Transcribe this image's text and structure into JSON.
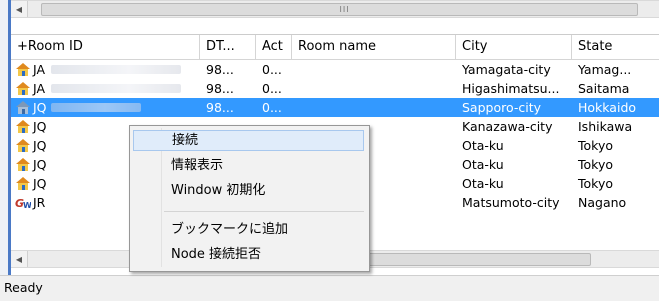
{
  "table": {
    "columns": [
      "+Room ID",
      "DT...",
      "Act",
      "Room name",
      "City",
      "State"
    ],
    "rows": [
      {
        "id_prefix": "JA",
        "dt": "98...",
        "act": "0...",
        "room": "",
        "city": "Yamagata-city",
        "state": "Yamag...",
        "icon": "house-icon",
        "selected": false
      },
      {
        "id_prefix": "JA",
        "dt": "98...",
        "act": "0...",
        "room": "",
        "city": "Higashimatsu...",
        "state": "Saitama",
        "icon": "house-icon",
        "selected": false
      },
      {
        "id_prefix": "JQ",
        "dt": "98...",
        "act": "0...",
        "room": "",
        "city": "Sapporo-city",
        "state": "Hokkaido",
        "icon": "house-icon",
        "selected": true
      },
      {
        "id_prefix": "JQ",
        "dt": "",
        "act": "",
        "room": "",
        "city": "Kanazawa-city",
        "state": "Ishikawa",
        "icon": "house-icon",
        "selected": false
      },
      {
        "id_prefix": "JQ",
        "dt": "",
        "act": "",
        "room": "",
        "city": "Ota-ku",
        "state": "Tokyo",
        "icon": "house-icon",
        "selected": false
      },
      {
        "id_prefix": "JQ",
        "dt": "",
        "act": "",
        "room": "",
        "city": "Ota-ku",
        "state": "Tokyo",
        "icon": "house-icon",
        "selected": false
      },
      {
        "id_prefix": "JQ",
        "dt": "",
        "act": "",
        "room": "",
        "city": "Ota-ku",
        "state": "Tokyo",
        "icon": "house-icon",
        "selected": false
      },
      {
        "id_prefix": "JR",
        "dt": "",
        "act": "",
        "room": "",
        "city": "Matsumoto-city",
        "state": "Nagano",
        "icon": "gateway-gw-icon",
        "selected": false
      }
    ]
  },
  "scrollbar": {
    "grip": "III"
  },
  "context_menu": {
    "items": [
      "接続",
      "情報表示",
      "Window 初期化",
      "ブックマークに追加",
      "Node 接続拒否"
    ],
    "highlighted": "接続"
  },
  "status_bar": {
    "text": "Ready"
  },
  "colors": {
    "selection": "#3399ff",
    "accent_border": "#4a79c6"
  }
}
